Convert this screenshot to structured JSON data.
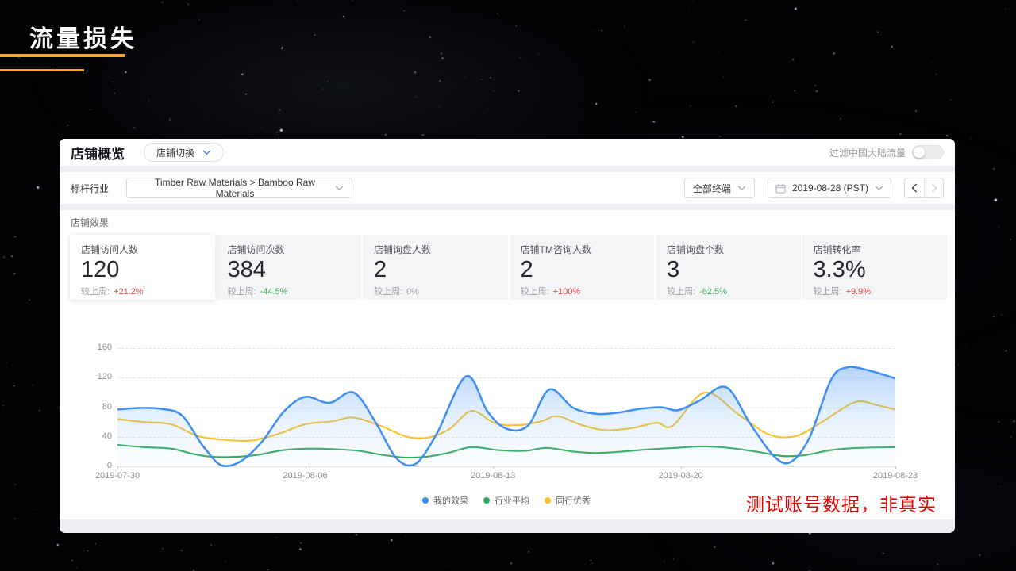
{
  "slide": {
    "title": "流量损失",
    "accent_bar_color": "#f0a233"
  },
  "panel": {
    "header": {
      "title": "店铺概览",
      "store_switch_label": "店铺切换",
      "traffic_filter_label": "过滤中国大陆流量",
      "traffic_filter_on": false
    },
    "filters": {
      "industry_label": "标杆行业",
      "industry_value": "Timber Raw Materials > Bamboo Raw Materials",
      "terminal_value": "全部终端",
      "date_value": "2019-08-28 (PST)"
    },
    "section_title": "店铺效果",
    "compare_label": "较上周:",
    "metrics": [
      {
        "label": "店铺访问人数",
        "value": "120",
        "delta": "+21.2%",
        "delta_color": "#e0474b",
        "selected": true
      },
      {
        "label": "店铺访问次数",
        "value": "384",
        "delta": "-44.5%",
        "delta_color": "#3fae5a",
        "selected": false
      },
      {
        "label": "店铺询盘人数",
        "value": "2",
        "delta": "0%",
        "delta_color": "#9a9ca1",
        "selected": false
      },
      {
        "label": "店铺TM咨询人数",
        "value": "2",
        "delta": "+100%",
        "delta_color": "#e0474b",
        "selected": false
      },
      {
        "label": "店铺询盘个数",
        "value": "3",
        "delta": "-62.5%",
        "delta_color": "#3fae5a",
        "selected": false
      },
      {
        "label": "店铺转化率",
        "value": "3.3%",
        "delta": "+9.9%",
        "delta_color": "#e0474b",
        "selected": false
      }
    ],
    "chart_data": {
      "type": "area-line",
      "grid": "dashed-horizontal",
      "legend_position": "bottom-center",
      "ylim": [
        0,
        160
      ],
      "yticks": [
        0,
        40,
        80,
        120,
        160
      ],
      "x_range_days": 29,
      "x_ticks": [
        {
          "day": 0,
          "label": "2019-07-30"
        },
        {
          "day": 7,
          "label": "2019-08-06"
        },
        {
          "day": 14,
          "label": "2019-08-13"
        },
        {
          "day": 21,
          "label": "2019-08-20"
        },
        {
          "day": 29,
          "label": "2019-08-28"
        }
      ],
      "series": [
        {
          "name": "我的效果",
          "color": "#3e8ef7",
          "fill": true,
          "points": [
            [
              0,
              78
            ],
            [
              0.8,
              80
            ],
            [
              1.6,
              79
            ],
            [
              2.4,
              70
            ],
            [
              3.2,
              28
            ],
            [
              3.9,
              2
            ],
            [
              4.6,
              8
            ],
            [
              5.4,
              35
            ],
            [
              6.2,
              75
            ],
            [
              7,
              95
            ],
            [
              7.9,
              87
            ],
            [
              8.8,
              101
            ],
            [
              9.6,
              62
            ],
            [
              10.4,
              12
            ],
            [
              11.1,
              4
            ],
            [
              11.9,
              45
            ],
            [
              13,
              123
            ],
            [
              13.8,
              75
            ],
            [
              14.5,
              52
            ],
            [
              15.3,
              56
            ],
            [
              16.1,
              105
            ],
            [
              17,
              80
            ],
            [
              17.9,
              72
            ],
            [
              18.7,
              74
            ],
            [
              19.5,
              79
            ],
            [
              20.3,
              81
            ],
            [
              20.9,
              77
            ],
            [
              21.7,
              90
            ],
            [
              22.7,
              108
            ],
            [
              23.6,
              58
            ],
            [
              24.5,
              14
            ],
            [
              25.1,
              7
            ],
            [
              25.8,
              40
            ],
            [
              26.6,
              118
            ],
            [
              27.2,
              135
            ],
            [
              28,
              131
            ],
            [
              29,
              120
            ]
          ]
        },
        {
          "name": "行业平均",
          "color": "#35a95c",
          "fill": false,
          "points": [
            [
              0,
              30
            ],
            [
              1,
              27
            ],
            [
              2,
              25
            ],
            [
              2.8,
              18
            ],
            [
              3.5,
              14
            ],
            [
              4.5,
              14
            ],
            [
              5.3,
              17
            ],
            [
              6.2,
              23
            ],
            [
              7.2,
              25
            ],
            [
              8.2,
              24
            ],
            [
              9,
              22
            ],
            [
              9.8,
              17
            ],
            [
              10.7,
              13
            ],
            [
              11.5,
              14
            ],
            [
              12.3,
              19
            ],
            [
              13.2,
              27
            ],
            [
              14.2,
              23
            ],
            [
              15.2,
              22
            ],
            [
              16,
              26
            ],
            [
              17,
              21
            ],
            [
              17.8,
              19
            ],
            [
              18.8,
              21
            ],
            [
              19.8,
              24
            ],
            [
              20.8,
              26
            ],
            [
              21.8,
              28
            ],
            [
              22.8,
              26
            ],
            [
              23.8,
              21
            ],
            [
              24.8,
              15
            ],
            [
              25.6,
              16
            ],
            [
              26.6,
              23
            ],
            [
              27.6,
              26
            ],
            [
              29,
              27
            ]
          ]
        },
        {
          "name": "同行优秀",
          "color": "#f7c22c",
          "fill": false,
          "points": [
            [
              0,
              65
            ],
            [
              1,
              61
            ],
            [
              2,
              58
            ],
            [
              3,
              42
            ],
            [
              4,
              37
            ],
            [
              5,
              36
            ],
            [
              6,
              45
            ],
            [
              7,
              58
            ],
            [
              8,
              62
            ],
            [
              8.8,
              67
            ],
            [
              9.8,
              56
            ],
            [
              10.8,
              41
            ],
            [
              11.6,
              40
            ],
            [
              12.4,
              52
            ],
            [
              13.2,
              76
            ],
            [
              14.1,
              59
            ],
            [
              15,
              57
            ],
            [
              15.8,
              62
            ],
            [
              16.4,
              69
            ],
            [
              17.3,
              57
            ],
            [
              18.2,
              50
            ],
            [
              19.2,
              53
            ],
            [
              20.1,
              60
            ],
            [
              20.7,
              56
            ],
            [
              21.9,
              101
            ],
            [
              23.2,
              70
            ],
            [
              24.3,
              44
            ],
            [
              25.3,
              42
            ],
            [
              26.3,
              62
            ],
            [
              27.5,
              88
            ],
            [
              28.3,
              84
            ],
            [
              29,
              78
            ]
          ]
        }
      ]
    },
    "watermark": "测试账号数据，非真实"
  },
  "icons": {
    "chevron-down": "v",
    "chevron-left": "<",
    "chevron-right": ">",
    "calendar": "▦",
    "legend-dot": "●"
  }
}
